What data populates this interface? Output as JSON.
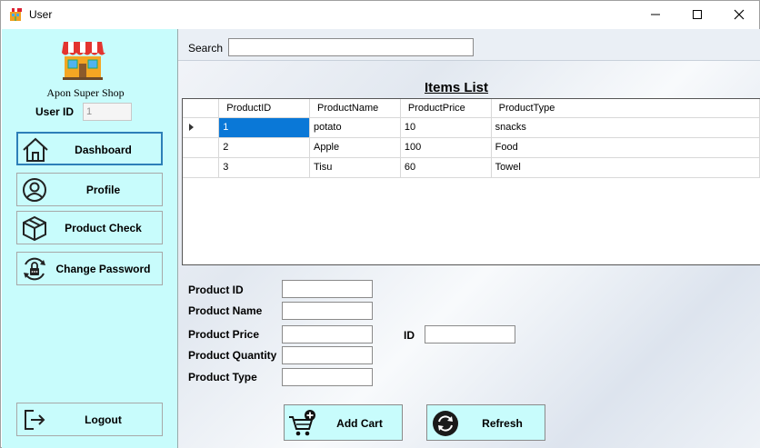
{
  "window": {
    "title": "User",
    "controls": {
      "minimize": "minimize-icon",
      "maximize": "maximize-icon",
      "close": "close-icon"
    }
  },
  "sidebar": {
    "shop_name": "Apon Super Shop",
    "user_id_label": "User ID",
    "user_id_value": "1",
    "nav": {
      "dashboard": "Dashboard",
      "profile": "Profile",
      "product_check": "Product Check",
      "change_password": "Change Password",
      "logout": "Logout"
    },
    "bg_color": "#c8fcfc",
    "active_item": "Dashboard"
  },
  "main": {
    "search_label": "Search",
    "search_value": "",
    "items_title": "Items List",
    "grid": {
      "columns": [
        "ProductID",
        "ProductName",
        "ProductPrice",
        "ProductType"
      ],
      "rows": [
        [
          "1",
          "potato",
          "10",
          "snacks"
        ],
        [
          "2",
          "Apple",
          "100",
          "Food"
        ],
        [
          "3",
          "Tisu",
          "60",
          "Towel"
        ]
      ],
      "selected_color": "#0a78d7"
    },
    "form": {
      "product_id": "Product ID",
      "product_name": "Product Name",
      "product_price": "Product Price",
      "product_quantity": "Product Quantity",
      "product_type": "Product Type",
      "id": "ID"
    },
    "buttons": {
      "add_cart": "Add Cart",
      "refresh": "Refresh"
    }
  }
}
